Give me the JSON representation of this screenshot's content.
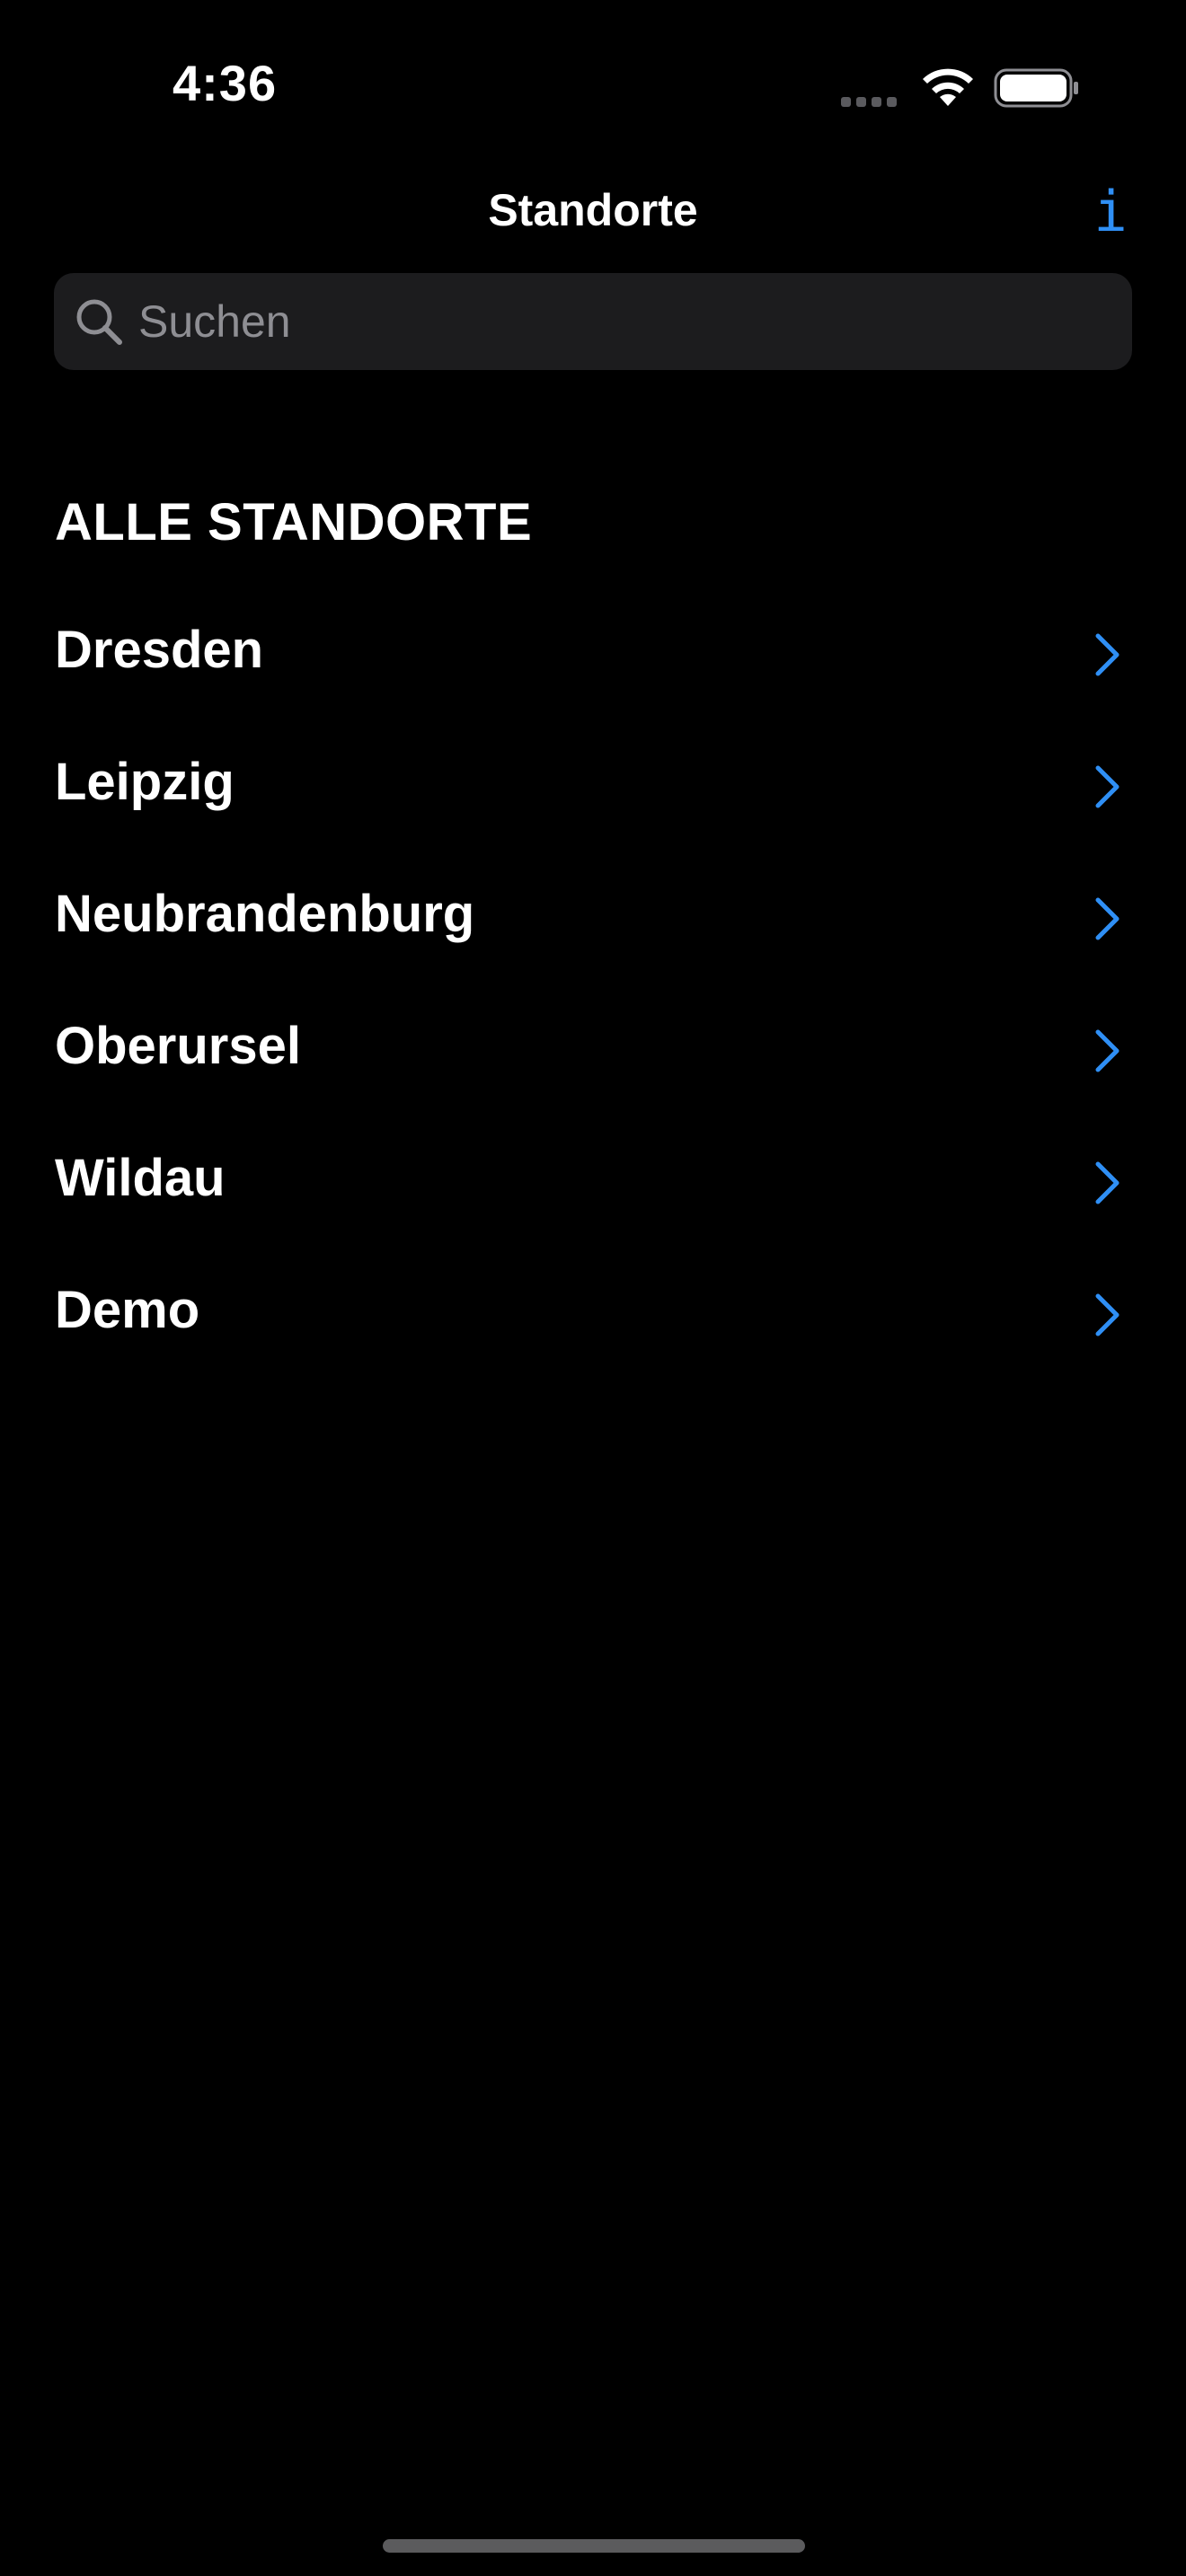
{
  "status_bar": {
    "time": "4:36"
  },
  "nav": {
    "title": "Standorte",
    "info_label": "i"
  },
  "search": {
    "placeholder": "Suchen"
  },
  "section": {
    "header": "ALLE STANDORTE",
    "items": [
      {
        "label": "Dresden"
      },
      {
        "label": "Leipzig"
      },
      {
        "label": "Neubrandenburg"
      },
      {
        "label": "Oberursel"
      },
      {
        "label": "Wildau"
      },
      {
        "label": "Demo"
      }
    ]
  },
  "colors": {
    "background": "#000000",
    "accent": "#2f8ff5",
    "search_bg": "#1c1c1e",
    "placeholder": "#8e8e93"
  },
  "icons": {
    "search": "search-icon",
    "info": "info-icon",
    "chevron": "chevron-right-icon",
    "wifi": "wifi-icon",
    "battery": "battery-icon"
  }
}
